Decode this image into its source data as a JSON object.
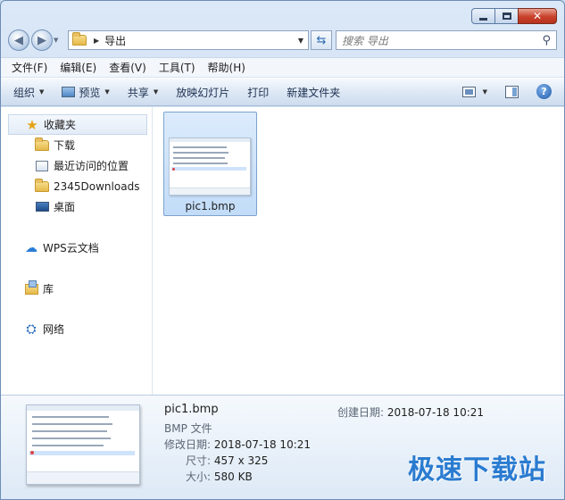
{
  "window": {
    "address": {
      "folder": "导出"
    },
    "search": {
      "placeholder": "搜索 导出"
    }
  },
  "menu": [
    "文件(F)",
    "编辑(E)",
    "查看(V)",
    "工具(T)",
    "帮助(H)"
  ],
  "commands": {
    "organize": "组织",
    "preview": "预览",
    "share": "共享",
    "slideshow": "放映幻灯片",
    "print": "打印",
    "new_folder": "新建文件夹"
  },
  "nav": {
    "favorites": "收藏夹",
    "downloads": "下载",
    "recent": "最近访问的位置",
    "downloads2345": "2345Downloads",
    "desktop": "桌面",
    "wps": "WPS云文档",
    "library": "库",
    "network": "网络"
  },
  "files": [
    {
      "name": "pic1.bmp",
      "selected": true
    }
  ],
  "details": {
    "name": "pic1.bmp",
    "type": "BMP 文件",
    "modified_label": "修改日期:",
    "modified": "2018-07-18 10:21",
    "created_label": "创建日期:",
    "created": "2018-07-18 10:21",
    "size_dim_label": "尺寸:",
    "dimensions": "457 x 325",
    "filesize_label": "大小:",
    "filesize": "580 KB"
  },
  "watermark": "极速下载站",
  "colors": {
    "accent": "#2a7bd0",
    "selection": "#c2dcf8"
  }
}
